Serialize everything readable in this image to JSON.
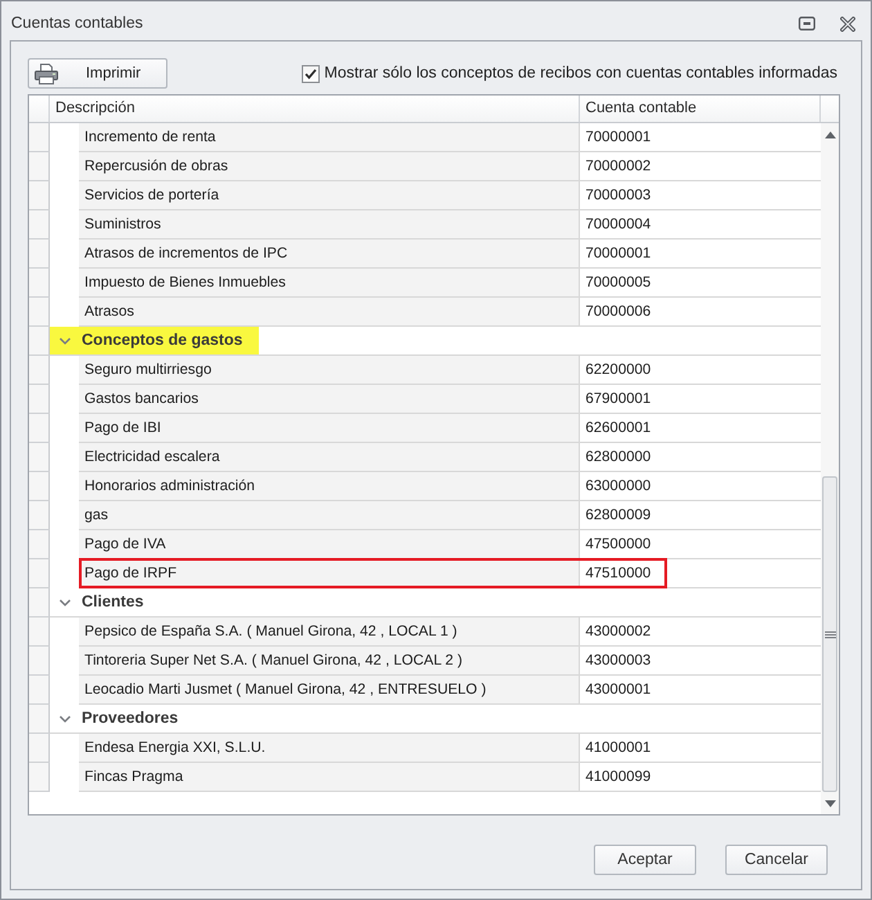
{
  "window": {
    "title": "Cuentas contables"
  },
  "toolbar": {
    "print_button": "Imprimir",
    "filter_checkbox": {
      "label": "Mostrar sólo los conceptos de recibos con cuentas contables informadas",
      "checked": true
    }
  },
  "table": {
    "columns": [
      "Descripción",
      "Cuenta contable"
    ],
    "groups": [
      {
        "children": [
          {
            "description": "Incremento de renta",
            "account": "70000001",
            "outlined": false
          },
          {
            "description": "Repercusión de obras",
            "account": "70000002",
            "outlined": false
          },
          {
            "description": "Servicios de portería",
            "account": "70000003",
            "outlined": false
          },
          {
            "description": "Suministros",
            "account": "70000004",
            "outlined": false
          },
          {
            "description": "Atrasos de incrementos de IPC",
            "account": "70000001",
            "outlined": false
          },
          {
            "description": "Impuesto de Bienes Inmuebles",
            "account": "70000005",
            "outlined": false
          },
          {
            "description": "Atrasos",
            "account": "70000006",
            "outlined": false
          }
        ]
      },
      {
        "label": "Conceptos de gastos",
        "expanded": true,
        "highlighted": true,
        "children": [
          {
            "description": "Seguro multirriesgo",
            "account": "62200000",
            "outlined": false
          },
          {
            "description": "Gastos bancarios",
            "account": "67900001",
            "outlined": false
          },
          {
            "description": "Pago de IBI",
            "account": "62600001",
            "outlined": false
          },
          {
            "description": "Electricidad escalera",
            "account": "62800000",
            "outlined": false
          },
          {
            "description": "Honorarios administración",
            "account": "63000000",
            "outlined": false
          },
          {
            "description": "gas",
            "account": "62800009",
            "outlined": false
          },
          {
            "description": "Pago de IVA",
            "account": "47500000",
            "outlined": false
          },
          {
            "description": "Pago de IRPF",
            "account": "47510000",
            "outlined": true
          }
        ]
      },
      {
        "label": "Clientes",
        "expanded": true,
        "highlighted": false,
        "children": [
          {
            "description": "Pepsico de España S.A. ( Manuel Girona, 42 , LOCAL 1 )",
            "account": "43000002",
            "outlined": false
          },
          {
            "description": "Tintoreria Super Net S.A. ( Manuel Girona, 42 , LOCAL 2 )",
            "account": "43000003",
            "outlined": false
          },
          {
            "description": "Leocadio Marti Jusmet ( Manuel Girona, 42 , ENTRESUELO )",
            "account": "43000001",
            "outlined": false
          }
        ]
      },
      {
        "label": "Proveedores",
        "expanded": true,
        "highlighted": false,
        "children": [
          {
            "description": "Endesa Energia XXI, S.L.U.",
            "account": "41000001",
            "outlined": false
          },
          {
            "description": "Fincas Pragma",
            "account": "41000099",
            "outlined": false
          }
        ]
      }
    ]
  },
  "buttons": [
    "Aceptar",
    "Cancelar"
  ]
}
